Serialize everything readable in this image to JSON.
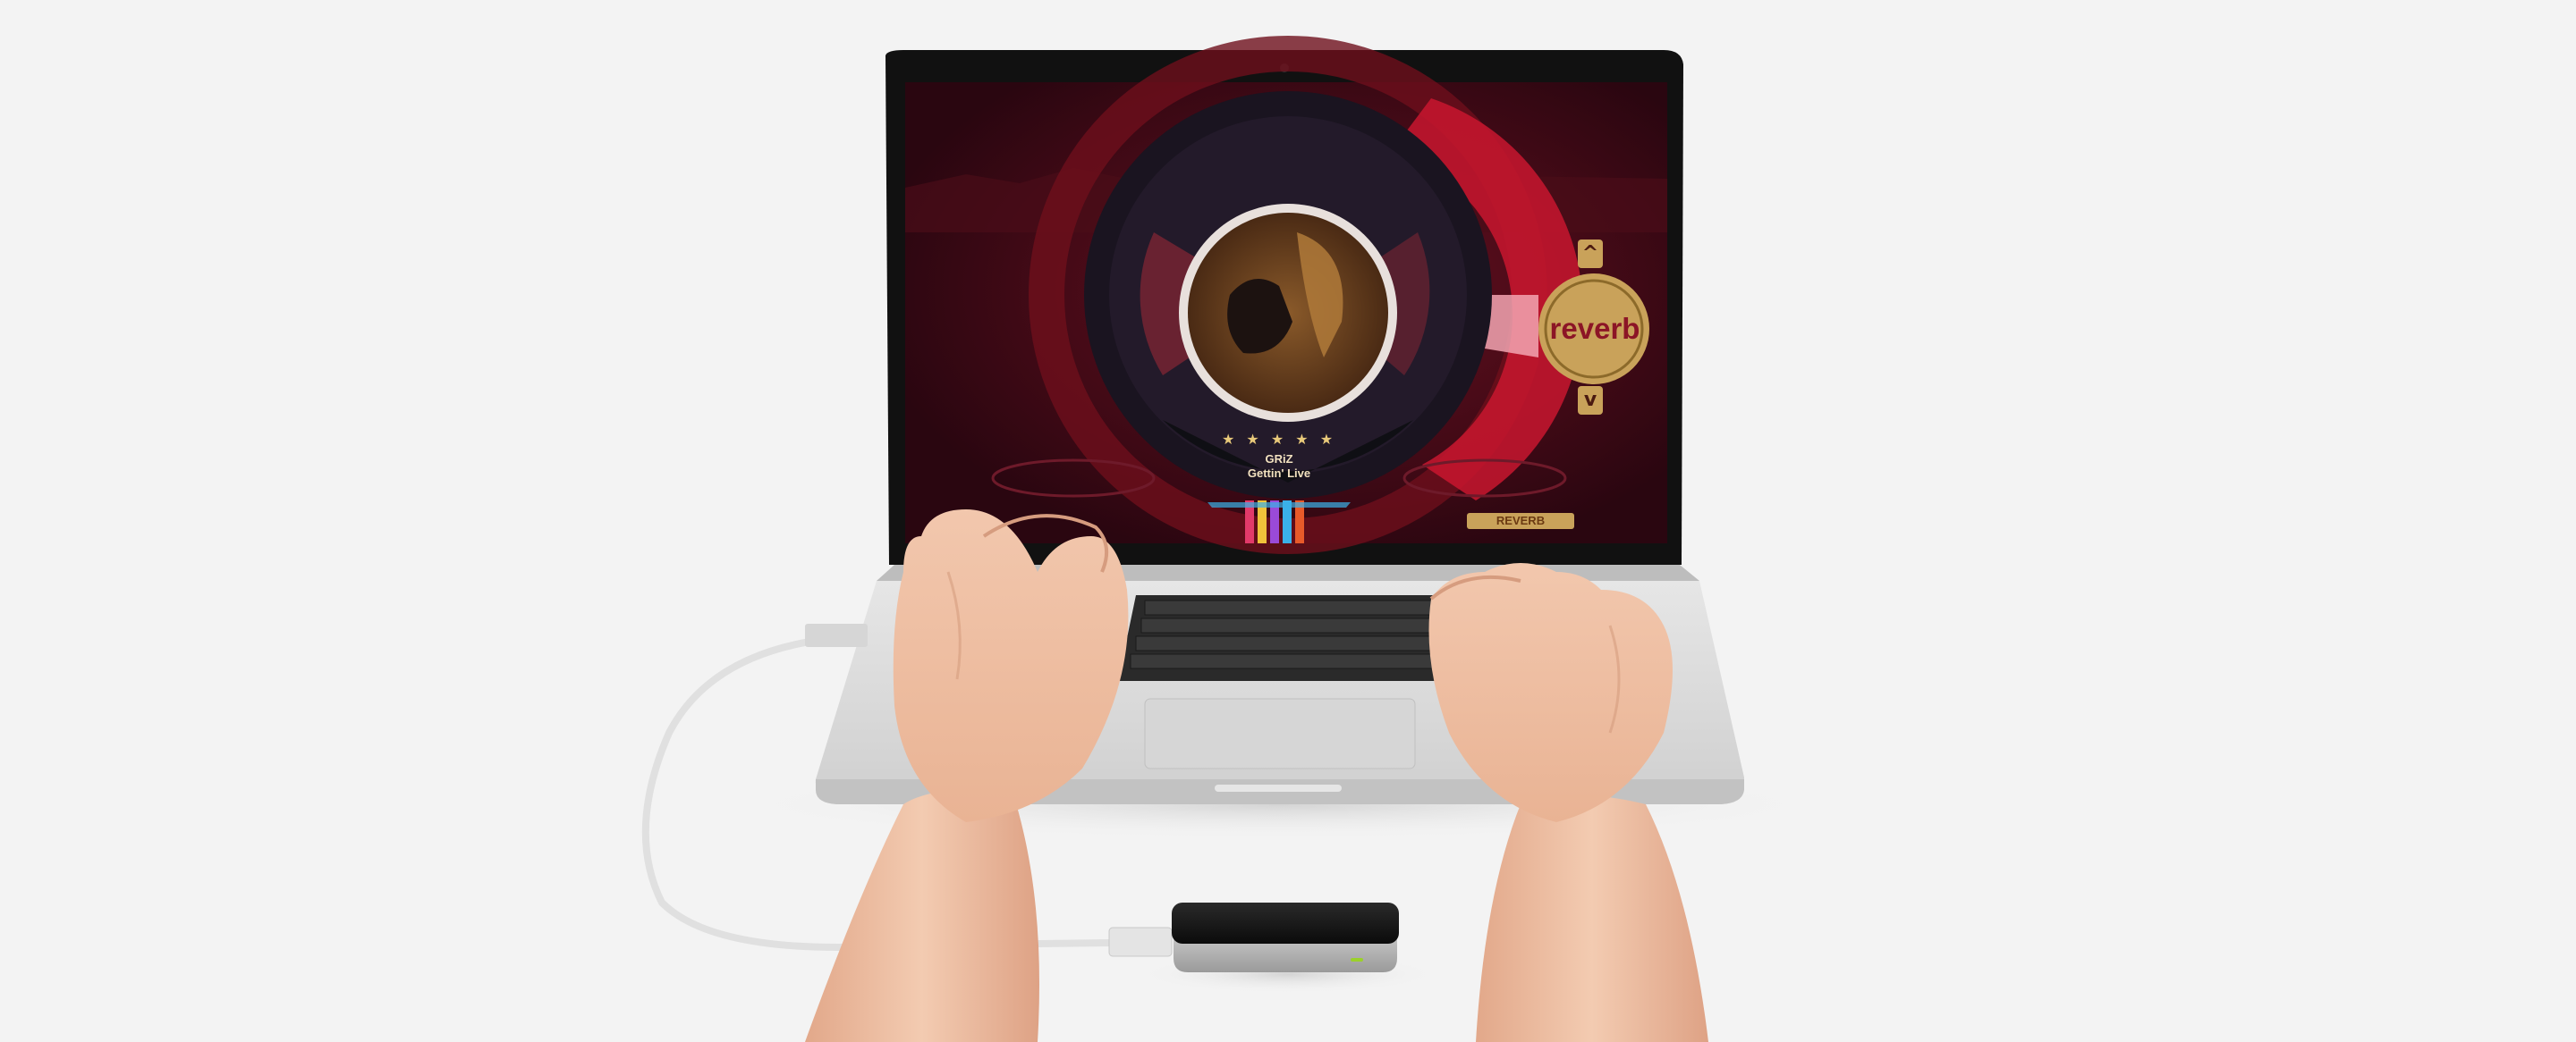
{
  "scene": {
    "subject": "hands-over-laptop-with-motion-controller",
    "colors": {
      "background": "#f3f3f3",
      "screen_bg": "#3b0a12",
      "accent_red": "#d11a3a",
      "gold": "#c9a25a",
      "led_green": "#9bd12a"
    }
  },
  "app": {
    "reverb_label": "reverb",
    "up_arrow": "^",
    "down_arrow": "v",
    "track_artist": "GRiZ",
    "track_title": "Gettin' Live",
    "rating": "★ ★ ★ ★ ★",
    "badge": "REVERB"
  },
  "icons": {
    "up": "chevron-up-icon",
    "down": "chevron-down-icon",
    "album": "album-art-icon"
  }
}
